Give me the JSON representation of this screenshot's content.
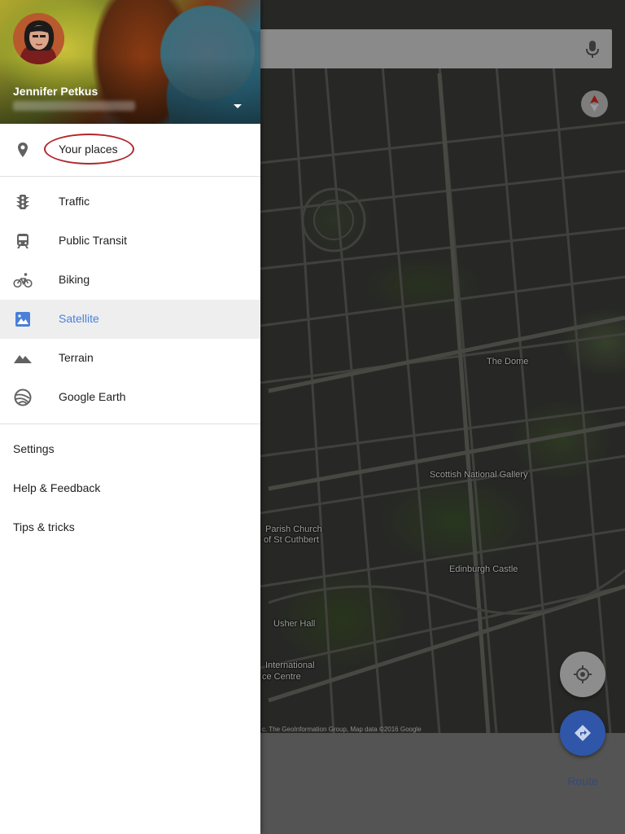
{
  "drawer": {
    "user_name": "Jennifer Petkus",
    "your_places_label": "Your places",
    "layers": [
      {
        "label": "Traffic",
        "icon": "traffic-light-icon",
        "active": false
      },
      {
        "label": "Public Transit",
        "icon": "train-icon",
        "active": false
      },
      {
        "label": "Biking",
        "icon": "bicycle-icon",
        "active": false
      },
      {
        "label": "Satellite",
        "icon": "satellite-image-icon",
        "active": true
      },
      {
        "label": "Terrain",
        "icon": "mountain-icon",
        "active": false
      },
      {
        "label": "Google Earth",
        "icon": "google-earth-icon",
        "active": false
      }
    ],
    "settings_label": "Settings",
    "help_label": "Help & Feedback",
    "tips_label": "Tips & tricks"
  },
  "map": {
    "place_labels": {
      "the_dome": "The Dome",
      "scottish_national_gallery": "Scottish National Gallery",
      "edinburgh_castle": "Edinburgh Castle",
      "parish_church_line1": "Parish Church",
      "parish_church_line2": "of St Cuthbert",
      "usher_hall": "Usher Hall",
      "international_line1": "International",
      "international_line2": "ce Centre"
    },
    "copyright": "c. The GeoInformation Group, Map data ©2016 Google"
  },
  "bottom_bar": {
    "route_label": "Route"
  },
  "colors": {
    "accent_blue": "#4a80d8",
    "fab_blue": "#2f56a8",
    "highlight_red": "#b1262b"
  }
}
